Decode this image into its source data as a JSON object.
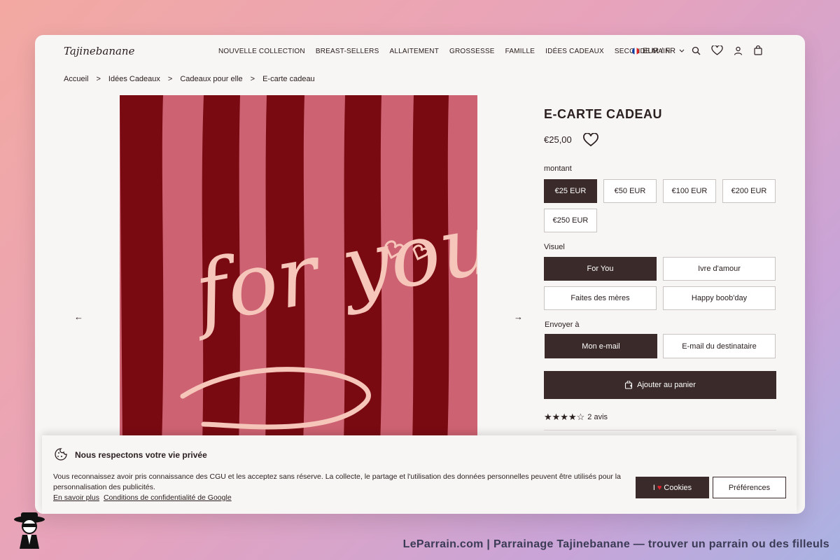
{
  "header": {
    "logo": "Tajinebanane",
    "nav": [
      "NOUVELLE COLLECTION",
      "BREAST-SELLERS",
      "ALLAITEMENT",
      "GROSSESSE",
      "FAMILLE",
      "IDÉES CADEAUX",
      "SECONDE MAIN"
    ],
    "currency": "EUR / FR"
  },
  "breadcrumb": [
    "Accueil",
    ">",
    "Idées Cadeaux",
    ">",
    "Cadeaux pour elle",
    ">",
    "E-carte cadeau"
  ],
  "product": {
    "title": "E-CARTE CADEAU",
    "price": "€25,00",
    "amount_label": "montant",
    "amounts": [
      "€25 EUR",
      "€50 EUR",
      "€100 EUR",
      "€200 EUR",
      "€250 EUR"
    ],
    "visual_label": "Visuel",
    "visuals": [
      "For You",
      "Ivre d'amour",
      "Faites des mères",
      "Happy boob'day"
    ],
    "send_label": "Envoyer à",
    "send_options": [
      "Mon e-mail",
      "E-mail du destinataire"
    ],
    "add_to_cart": "Ajouter au panier",
    "rating_stars": "★★★★☆",
    "reviews": "2 avis",
    "image_text": "for you"
  },
  "cookie": {
    "title": "Nous respectons votre vie privée",
    "text": "Vous reconnaissez avoir pris connaissance des CGU et les acceptez sans réserve. La collecte, le partage et l'utilisation des données personnelles peuvent être utilisés pour la personnalisation des publicités.",
    "link1": "En savoir plus",
    "link2": "Conditions de confidentialité de Google",
    "accept_prefix": "I",
    "accept_suffix": "Cookies",
    "preferences": "Préférences"
  },
  "footer": {
    "caption": "LeParrain.com | Parrainage Tajinebanane — trouver un parrain ou des filleuls"
  },
  "colors": {
    "accent": "#3a2a2a",
    "stripe_dark": "#7a0a12",
    "stripe_light": "#cd6272",
    "script": "#f6c6bb"
  }
}
